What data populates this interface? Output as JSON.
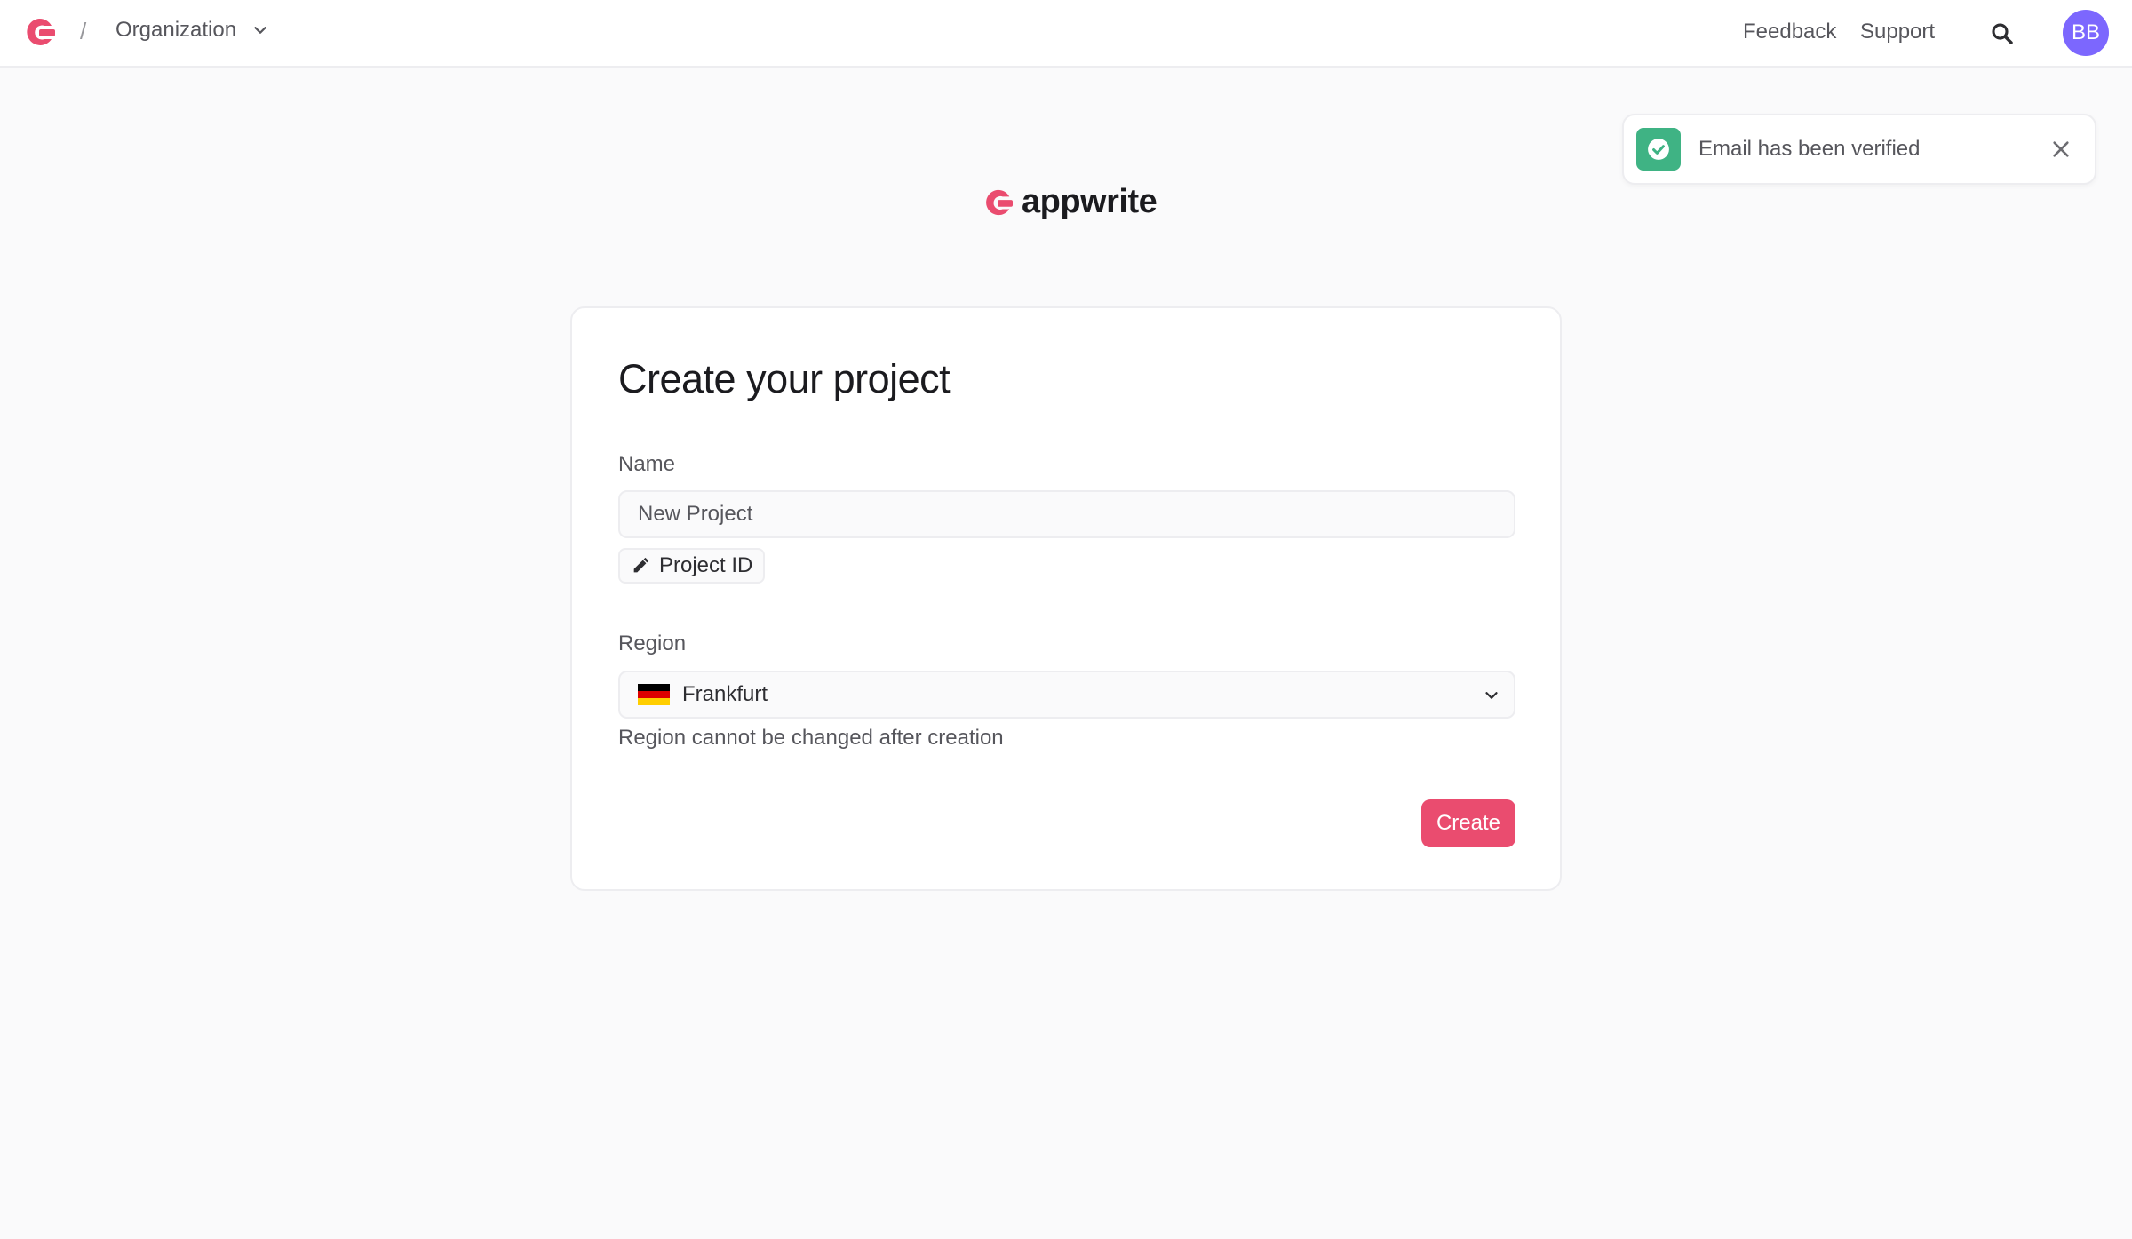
{
  "topbar": {
    "separator": "/",
    "organization_label": "Organization",
    "feedback_label": "Feedback",
    "support_label": "Support",
    "avatar_initials": "BB"
  },
  "toast": {
    "message": "Email has been verified",
    "status_color": "#3fb384"
  },
  "brand": {
    "name": "appwrite",
    "accent_color": "#ea4c6f"
  },
  "form": {
    "title": "Create your project",
    "name_label": "Name",
    "name_placeholder": "New Project",
    "project_id_label": "Project ID",
    "region_label": "Region",
    "region_value": "Frankfurt",
    "region_flag": "germany-flag",
    "region_hint": "Region cannot be changed after creation",
    "create_label": "Create"
  },
  "icons": [
    "appwrite-logo-icon",
    "chevron-down-icon",
    "search-icon",
    "check-circle-icon",
    "close-icon",
    "pencil-icon"
  ]
}
